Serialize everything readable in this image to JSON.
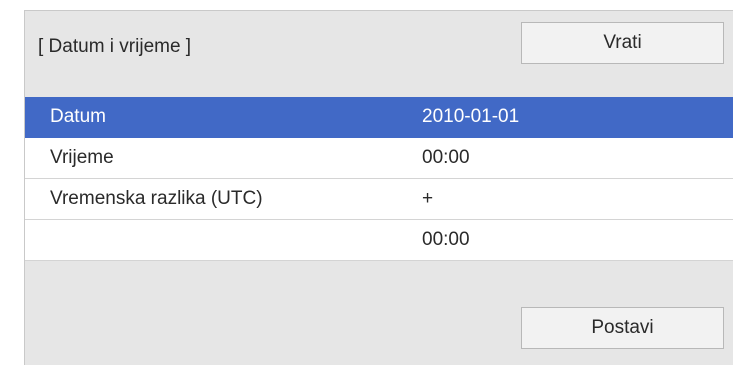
{
  "dialog": {
    "title": "[ Datum i vrijeme ]",
    "back_label": "Vrati",
    "set_label": "Postavi"
  },
  "rows": [
    {
      "label": "Datum",
      "value": "2010-01-01",
      "selected": true
    },
    {
      "label": "Vrijeme",
      "value": "00:00",
      "selected": false
    },
    {
      "label": "Vremenska razlika (UTC)",
      "value": "+",
      "selected": false
    },
    {
      "label": "",
      "value": "00:00",
      "selected": false
    }
  ],
  "colors": {
    "selection": "#4169c6",
    "panel_background": "#e6e6e6"
  }
}
